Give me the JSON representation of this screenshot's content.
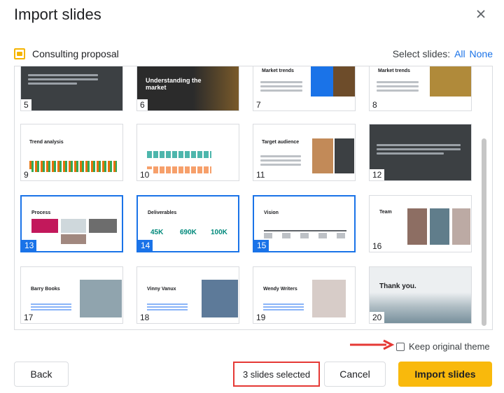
{
  "dialog": {
    "title": "Import slides",
    "presentation_name": "Consulting proposal",
    "select_label": "Select slides:",
    "select_all": "All",
    "select_none": "None",
    "keep_theme_label": "Keep original theme",
    "keep_theme_checked": false,
    "back_label": "Back",
    "selected_count_label": "3 slides selected",
    "cancel_label": "Cancel",
    "import_label": "Import slides"
  },
  "slides": [
    {
      "number": "5",
      "selected": false,
      "title": ""
    },
    {
      "number": "6",
      "selected": false,
      "title": "Understanding the market"
    },
    {
      "number": "7",
      "selected": false,
      "title": "Market trends"
    },
    {
      "number": "8",
      "selected": false,
      "title": "Market trends"
    },
    {
      "number": "9",
      "selected": false,
      "title": "Trend analysis"
    },
    {
      "number": "10",
      "selected": false,
      "title": ""
    },
    {
      "number": "11",
      "selected": false,
      "title": "Target audience"
    },
    {
      "number": "12",
      "selected": false,
      "title": ""
    },
    {
      "number": "13",
      "selected": true,
      "title": "Process"
    },
    {
      "number": "14",
      "selected": true,
      "title": "Deliverables",
      "stats": [
        "45K",
        "690K",
        "100K"
      ]
    },
    {
      "number": "15",
      "selected": true,
      "title": "Vision"
    },
    {
      "number": "16",
      "selected": false,
      "title": "Team"
    },
    {
      "number": "17",
      "selected": false,
      "title": "Barry Books"
    },
    {
      "number": "18",
      "selected": false,
      "title": "Vinny Vanux"
    },
    {
      "number": "19",
      "selected": false,
      "title": "Wendy Writers"
    },
    {
      "number": "20",
      "selected": false,
      "title": "Thank you."
    }
  ]
}
